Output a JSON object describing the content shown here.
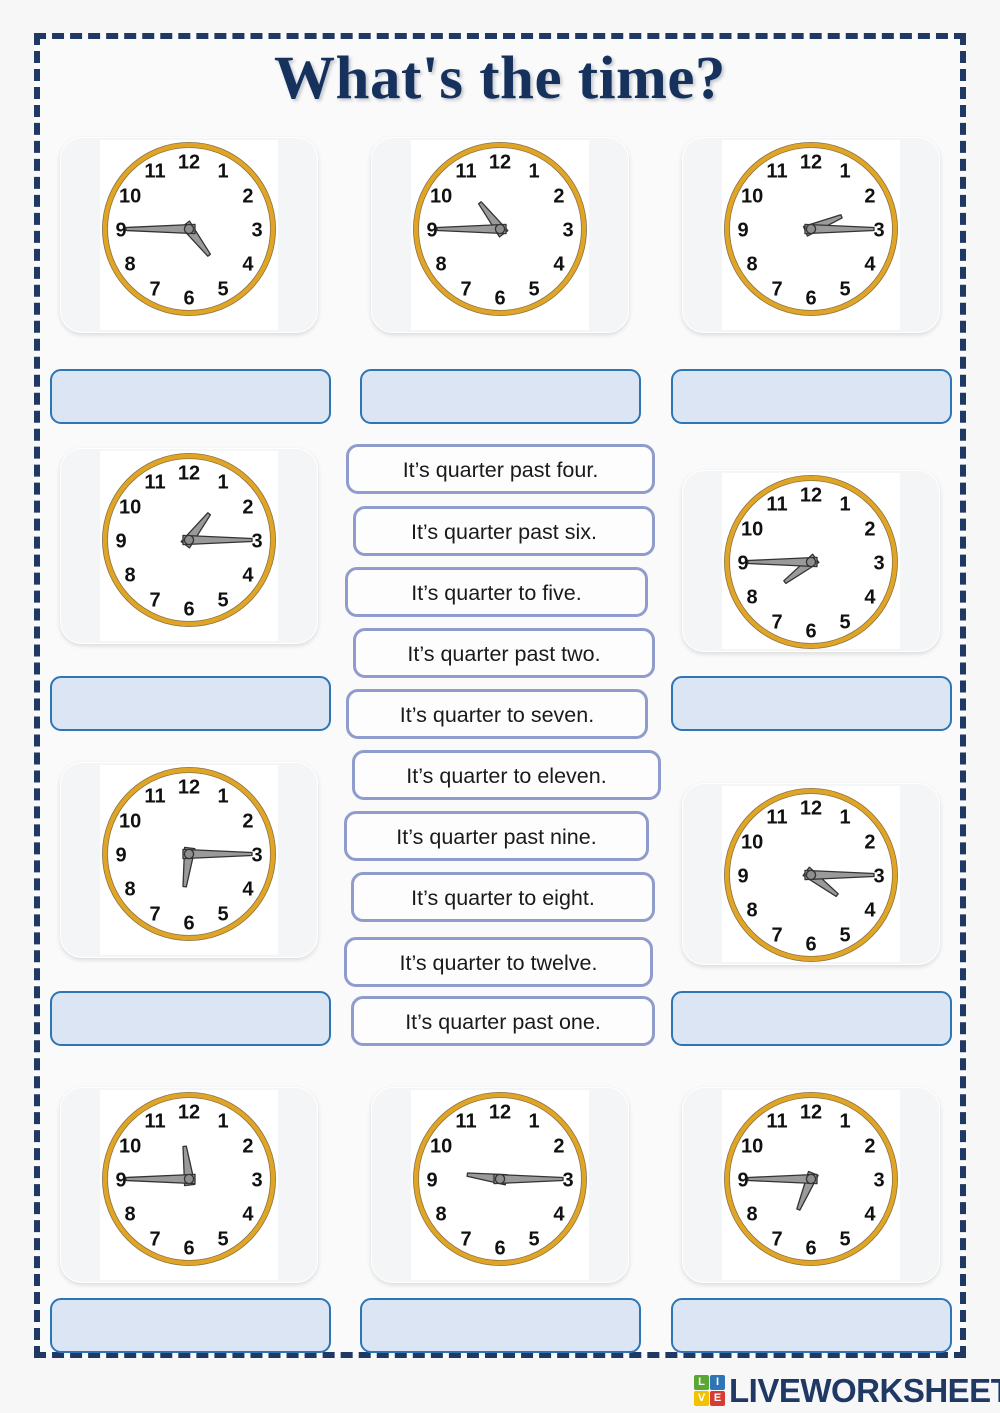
{
  "page": {
    "title": "What's the time?",
    "background_color": "#f7f7f7",
    "frame_border_color": "#1f3864",
    "title_color": "#16325c",
    "answer_box_fill": "#dbe5f4",
    "answer_box_border": "#2e75b6",
    "option_border": "#8f9ccc",
    "clock_rim_color": "#e0a526",
    "clock_hand_color": "#9a9a9a"
  },
  "clocks": [
    {
      "id": "clock-1",
      "row": 1,
      "col": 1,
      "hour_angle": 142.5,
      "minute_angle": 270,
      "time": "4:45",
      "answer": "It's quarter to five."
    },
    {
      "id": "clock-2",
      "row": 1,
      "col": 2,
      "hour_angle": 322.5,
      "minute_angle": 270,
      "time": "10:45",
      "answer": "It's quarter to eleven."
    },
    {
      "id": "clock-3",
      "row": 1,
      "col": 3,
      "hour_angle": 67.5,
      "minute_angle": 90,
      "time": "2:15",
      "answer": "It's quarter past two."
    },
    {
      "id": "clock-4",
      "row": 2,
      "col": 1,
      "hour_angle": 37.5,
      "minute_angle": 90,
      "time": "1:15",
      "answer": "It's quarter past one."
    },
    {
      "id": "clock-5",
      "row": 2,
      "col": 3,
      "hour_angle": 232.5,
      "minute_angle": 270,
      "time": "7:45",
      "answer": "It's quarter to eight."
    },
    {
      "id": "clock-6",
      "row": 3,
      "col": 1,
      "hour_angle": 187.5,
      "minute_angle": 90,
      "time": "6:15",
      "answer": "It's quarter past six."
    },
    {
      "id": "clock-7",
      "row": 3,
      "col": 3,
      "hour_angle": 127.5,
      "minute_angle": 90,
      "time": "4:15",
      "answer": "It's quarter past four."
    },
    {
      "id": "clock-8",
      "row": 4,
      "col": 1,
      "hour_angle": 352.5,
      "minute_angle": 270,
      "time": "11:45",
      "answer": "It's quarter to twelve."
    },
    {
      "id": "clock-9",
      "row": 4,
      "col": 2,
      "hour_angle": 277.5,
      "minute_angle": 90,
      "time": "9:15",
      "answer": "It's quarter past nine."
    },
    {
      "id": "clock-10",
      "row": 4,
      "col": 3,
      "hour_angle": 202.5,
      "minute_angle": 270,
      "time": "6:45",
      "answer": "It's quarter to seven."
    }
  ],
  "clock_numerals": [
    "12",
    "1",
    "2",
    "3",
    "4",
    "5",
    "6",
    "7",
    "8",
    "9",
    "10",
    "11"
  ],
  "options": [
    {
      "id": "option-1",
      "label": "It’s quarter past four."
    },
    {
      "id": "option-2",
      "label": "It’s quarter past six."
    },
    {
      "id": "option-3",
      "label": "It’s quarter to five."
    },
    {
      "id": "option-4",
      "label": "It’s quarter past two."
    },
    {
      "id": "option-5",
      "label": "It’s quarter to seven."
    },
    {
      "id": "option-6",
      "label": "It’s quarter to eleven."
    },
    {
      "id": "option-7",
      "label": "It’s quarter past nine."
    },
    {
      "id": "option-8",
      "label": "It’s quarter to eight."
    },
    {
      "id": "option-9",
      "label": "It’s quarter to twelve."
    },
    {
      "id": "option-10",
      "label": "It’s quarter past one."
    }
  ],
  "answer_boxes": [
    {
      "id": "answer-box-1",
      "value": "",
      "placeholder": ""
    },
    {
      "id": "answer-box-2",
      "value": "",
      "placeholder": ""
    },
    {
      "id": "answer-box-3",
      "value": "",
      "placeholder": ""
    },
    {
      "id": "answer-box-4",
      "value": "",
      "placeholder": ""
    },
    {
      "id": "answer-box-5",
      "value": "",
      "placeholder": ""
    },
    {
      "id": "answer-box-6",
      "value": "",
      "placeholder": ""
    },
    {
      "id": "answer-box-7",
      "value": "",
      "placeholder": ""
    },
    {
      "id": "answer-box-8",
      "value": "",
      "placeholder": ""
    },
    {
      "id": "answer-box-9",
      "value": "",
      "placeholder": ""
    },
    {
      "id": "answer-box-10",
      "value": "",
      "placeholder": ""
    }
  ],
  "footer": {
    "brand": "LIVEWORKSHEETS",
    "logo_tiles": [
      {
        "letter": "L",
        "color": "#5aa832"
      },
      {
        "letter": "I",
        "color": "#2e75b6"
      },
      {
        "letter": "V",
        "color": "#f2c200"
      },
      {
        "letter": "E",
        "color": "#d83b34"
      }
    ]
  }
}
